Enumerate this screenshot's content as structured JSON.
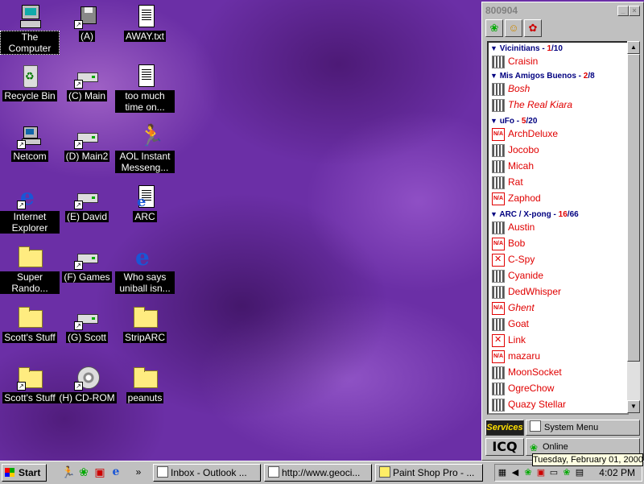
{
  "desktop": {
    "icons": {
      "computer": "The Computer",
      "drive_a": "(A)",
      "away_txt": "AWAY.txt",
      "recycle_bin": "Recycle Bin",
      "drive_c": "(C) Main",
      "too_much": "too much time on...",
      "netcom": "Netcom",
      "drive_d": "(D) Main2",
      "aim": "AOL Instant Messeng...",
      "ie": "Internet Explorer",
      "drive_e": "(E) David",
      "arc": "ARC",
      "super_random": "Super Rando...",
      "drive_f": "(F) Games",
      "who_says": "Who says uniball isn...",
      "scotts_stuff_1": "Scott's Stuff",
      "drive_g": "(G) Scott",
      "striparc": "StripARC",
      "scotts_stuff_2": "Scott's Stuff",
      "drive_h": "(H) CD-ROM",
      "peanuts": "peanuts"
    }
  },
  "icq": {
    "uin": "800904",
    "groups": [
      {
        "name": "Vicinitians - ",
        "online": "1",
        "total": "/10",
        "contacts": [
          {
            "name": "Craisin"
          }
        ]
      },
      {
        "name": "Mis Amigos Buenos - ",
        "online": "2",
        "total": "/8",
        "contacts": [
          {
            "name": "Bosh"
          },
          {
            "name": "The Real Kiara"
          }
        ]
      },
      {
        "name": "uFo - ",
        "online": "5",
        "total": "/20",
        "contacts": [
          {
            "name": "ArchDeluxe"
          },
          {
            "name": "Jocobo"
          },
          {
            "name": "Micah"
          },
          {
            "name": "Rat"
          },
          {
            "name": "Zaphod"
          }
        ]
      },
      {
        "name": "ARC / X-pong - ",
        "online": "16",
        "total": "/66",
        "contacts": [
          {
            "name": "Austin"
          },
          {
            "name": "Bob"
          },
          {
            "name": "C-Spy"
          },
          {
            "name": "Cyanide"
          },
          {
            "name": "DedWhisper"
          },
          {
            "name": "Ghent"
          },
          {
            "name": "Goat"
          },
          {
            "name": "Link"
          },
          {
            "name": "mazaru"
          },
          {
            "name": "MoonSocket"
          },
          {
            "name": "OgreChow"
          },
          {
            "name": "Quazy Stellar"
          }
        ]
      }
    ],
    "services_label": "Services",
    "system_menu_label": "System Menu",
    "logo_text": "ICQ",
    "status_label": "Online"
  },
  "tooltip": "Tuesday, February 01, 2000",
  "taskbar": {
    "start_label": "Start",
    "chevron": "»",
    "tasks": [
      "Inbox - Outlook ...",
      "http://www.geoci...",
      "Paint Shop Pro - ..."
    ],
    "clock": "4:02 PM"
  }
}
